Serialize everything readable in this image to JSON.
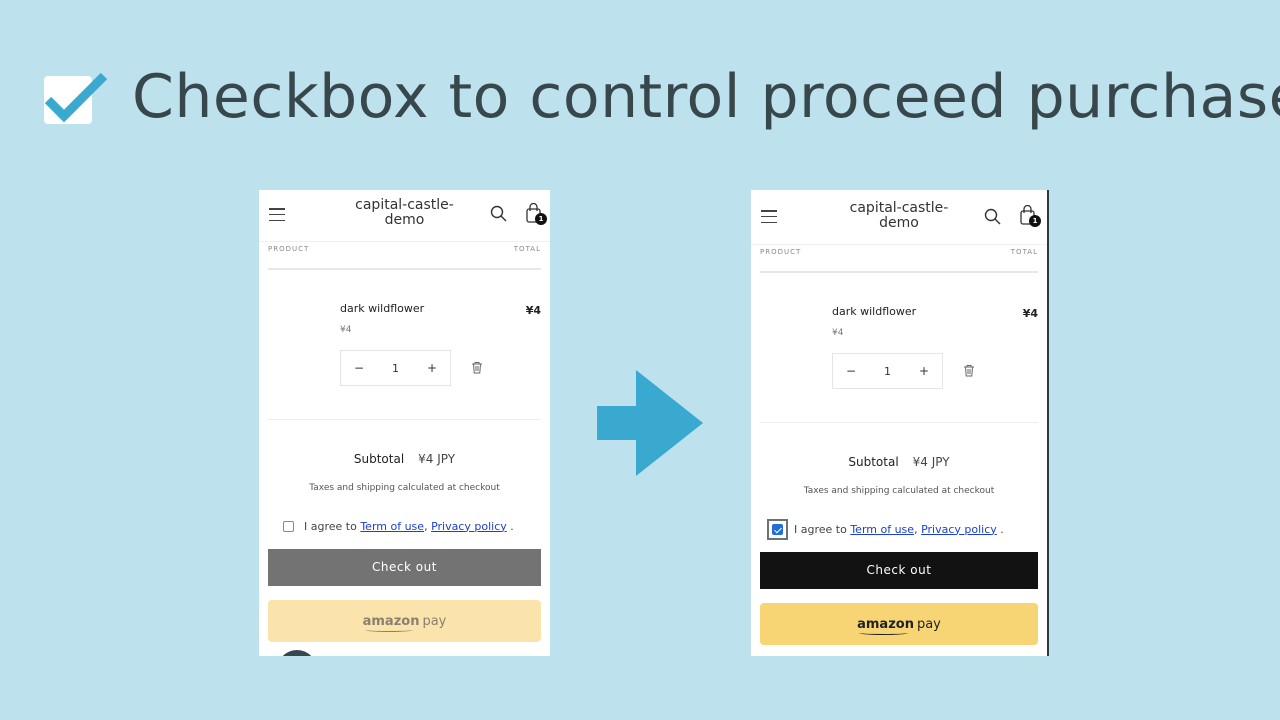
{
  "headline": {
    "icon": "checkbox-checked-icon",
    "text": "Checkbox to control proceed purchase",
    "accent_color": "#3aa9cf"
  },
  "arrow": {
    "icon": "arrow-right-icon",
    "color": "#3aa9cf"
  },
  "panels": [
    {
      "state": "before",
      "store_name_line1": "capital-castle-",
      "store_name_line2": "demo",
      "cart_count": "1",
      "columns": {
        "product": "PRODUCT",
        "total": "TOTAL"
      },
      "item": {
        "name": "dark wildflower",
        "unit_price": "¥4",
        "total": "¥4",
        "quantity": "1",
        "minus": "−",
        "plus": "+"
      },
      "subtotal_label": "Subtotal",
      "subtotal_value": "¥4 JPY",
      "taxes_note": "Taxes and shipping calculated at checkout",
      "agree_prefix": "I agree to ",
      "terms_link": "Term of use",
      "separator": ", ",
      "privacy_link": "Privacy policy",
      "agree_suffix": " .",
      "agree_checked": false,
      "checkout_label": "Check out",
      "checkout_enabled": false,
      "amazon_pay_brand": "amazon",
      "amazon_pay_suffix": "pay"
    },
    {
      "state": "after",
      "store_name_line1": "capital-castle-",
      "store_name_line2": "demo",
      "cart_count": "1",
      "columns": {
        "product": "PRODUCT",
        "total": "TOTAL"
      },
      "item": {
        "name": "dark wildflower",
        "unit_price": "¥4",
        "total": "¥4",
        "quantity": "1",
        "minus": "−",
        "plus": "+"
      },
      "subtotal_label": "Subtotal",
      "subtotal_value": "¥4 JPY",
      "taxes_note": "Taxes and shipping calculated at checkout",
      "agree_prefix": "I agree to ",
      "terms_link": "Term of use",
      "separator": ", ",
      "privacy_link": "Privacy policy",
      "agree_suffix": " .",
      "agree_checked": true,
      "checkout_label": "Check out",
      "checkout_enabled": true,
      "amazon_pay_brand": "amazon",
      "amazon_pay_suffix": "pay"
    }
  ]
}
